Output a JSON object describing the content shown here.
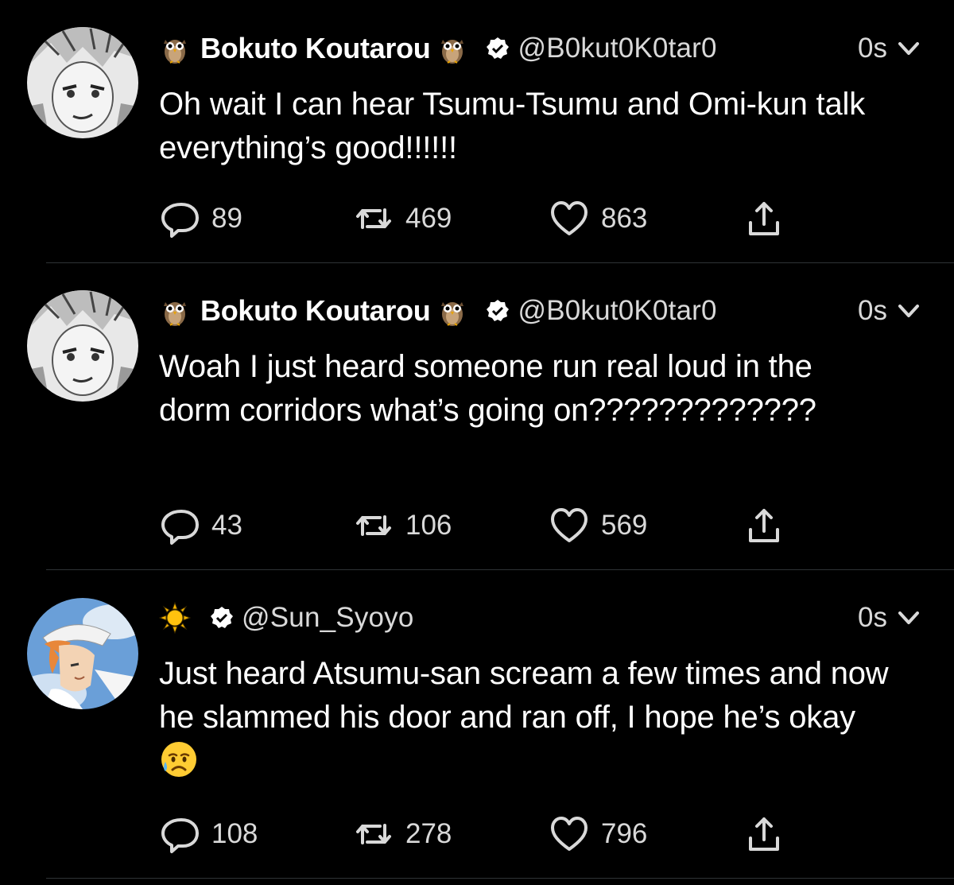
{
  "colors": {
    "background": "#000000",
    "text": "#ffffff",
    "secondary_text": "#d9d9d9",
    "divider": "#2f3336"
  },
  "tweets": [
    {
      "avatar": "bokuto-avatar",
      "name_prefix_icon": "owl-emoji",
      "display_name": "Bokuto Koutarou",
      "name_suffix_icon": "owl-emoji",
      "verified_icon": "verified-badge-icon",
      "handle": "@B0kut0K0tar0",
      "time": "0s",
      "text": "Oh wait I can hear Tsumu-Tsumu and Omi-kun talk everything’s good!!!!!!",
      "replies": "89",
      "retweets": "469",
      "likes": "863"
    },
    {
      "avatar": "bokuto-avatar",
      "name_prefix_icon": "owl-emoji",
      "display_name": "Bokuto Koutarou",
      "name_suffix_icon": "owl-emoji",
      "verified_icon": "verified-badge-icon",
      "handle": "@B0kut0K0tar0",
      "time": "0s",
      "text": "Woah I just heard someone run real loud in the dorm corridors what’s going on?????????????",
      "replies": "43",
      "retweets": "106",
      "likes": "569"
    },
    {
      "avatar": "hinata-avatar",
      "name_prefix_icon": "sun-emoji",
      "display_name": "",
      "verified_icon": "verified-badge-icon",
      "handle": "@Sun_Syoyo",
      "time": "0s",
      "text": "Just heard Atsumu-san scream a few times and now he slammed his door and ran off, I hope he’s okay",
      "text_suffix_icon": "sad-relieved-face-emoji",
      "replies": "108",
      "retweets": "278",
      "likes": "796"
    }
  ]
}
